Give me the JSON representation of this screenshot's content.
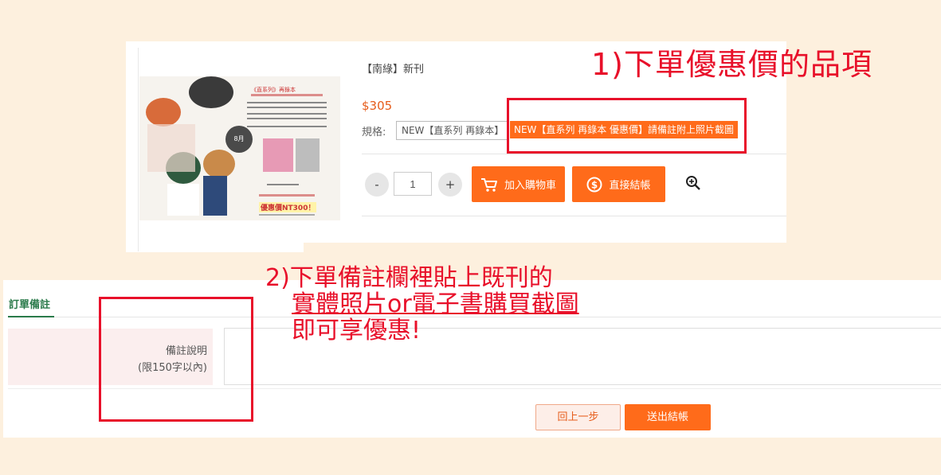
{
  "product": {
    "name": "【南綠】新刊",
    "price": "$305",
    "spec_label": "規格:",
    "spec_options": [
      "NEW【直系列 再錄本】",
      "NEW【直系列 再錄本 優惠價】請備註附上照片截圖"
    ],
    "selected_spec_index": 1,
    "quantity": "1",
    "qty_minus": "-",
    "qty_plus": "+",
    "add_to_cart": "加入購物車",
    "checkout": "直接結帳",
    "poster": {
      "title": "《直系列》再錄本",
      "badge": "8月",
      "price_text": "優惠價NT300！"
    }
  },
  "order_notes": {
    "tab": "訂單備註",
    "label_line1": "備註說明",
    "label_line2": "(限150字以內)",
    "textarea_value": "",
    "back_button": "回上一步",
    "submit_button": "送出結帳"
  },
  "annotations": {
    "step1": "1)下單優惠價的品項",
    "step2_line1": "2)下單備註欄裡貼上既刊的",
    "step2_line2": "實體照片or電子書購買截圖",
    "step2_line3": "即可享優惠!"
  },
  "colors": {
    "accent": "#ff6b1a",
    "price": "#e65c1a",
    "annotation": "#e8102a",
    "tab_green": "#2a7a4a",
    "background": "#fdf0de"
  },
  "icons": [
    "cart-icon",
    "coin-icon",
    "zoom-in-icon"
  ]
}
